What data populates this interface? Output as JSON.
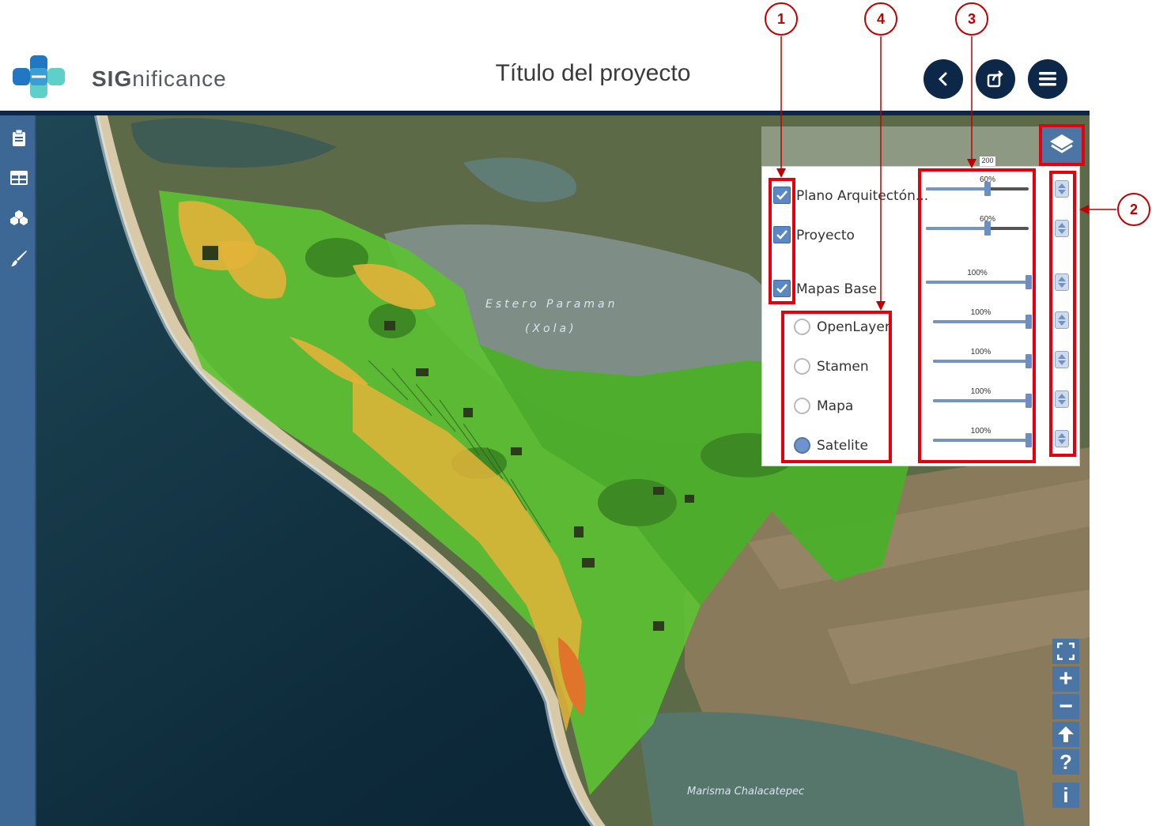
{
  "header": {
    "brand_bold": "SIG",
    "brand_rest": "nificance",
    "title": "Título del proyecto",
    "buttons": [
      "back-icon",
      "share-icon",
      "menu-icon"
    ]
  },
  "sidebar": {
    "items": [
      "clipboard-icon",
      "table-icon",
      "cubes-icon",
      "brush-icon"
    ]
  },
  "map": {
    "labels": {
      "lagoon_1": "Estero Paraman",
      "lagoon_2": "(Xola)",
      "marsh": "Marisma Chalacatepec",
      "road": "200"
    }
  },
  "layers": {
    "items": [
      {
        "label": "Plano Arquitectón...",
        "checked": true,
        "opacity_label": "60%",
        "opacity": 0.6
      },
      {
        "label": "Proyecto",
        "checked": true,
        "opacity_label": "60%",
        "opacity": 0.6
      },
      {
        "label": "Mapas Base",
        "checked": true,
        "opacity_label": "100%",
        "opacity": 1.0
      }
    ],
    "basemaps": [
      {
        "label": "OpenLayer",
        "selected": false,
        "opacity_label": "100%",
        "opacity": 1.0
      },
      {
        "label": "Stamen",
        "selected": false,
        "opacity_label": "100%",
        "opacity": 1.0
      },
      {
        "label": "Mapa",
        "selected": false,
        "opacity_label": "100%",
        "opacity": 1.0
      },
      {
        "label": "Satelite",
        "selected": true,
        "opacity_label": "100%",
        "opacity": 1.0
      }
    ]
  },
  "map_controls": [
    "fullscreen-icon",
    "zoom-in-icon",
    "zoom-out-icon",
    "north-arrow-icon",
    "help-icon",
    "info-icon"
  ],
  "map_controls_labels": {
    "zoom_in": "+",
    "zoom_out": "−",
    "help": "?",
    "info": "i"
  },
  "annotations": [
    "1",
    "2",
    "3",
    "4"
  ],
  "colors": {
    "navy": "#0c2748",
    "accent_blue": "#4a75a5",
    "highlight_red": "#e3000f",
    "vegetation_green": "#5cc232",
    "project_yellow": "#e2b338"
  }
}
